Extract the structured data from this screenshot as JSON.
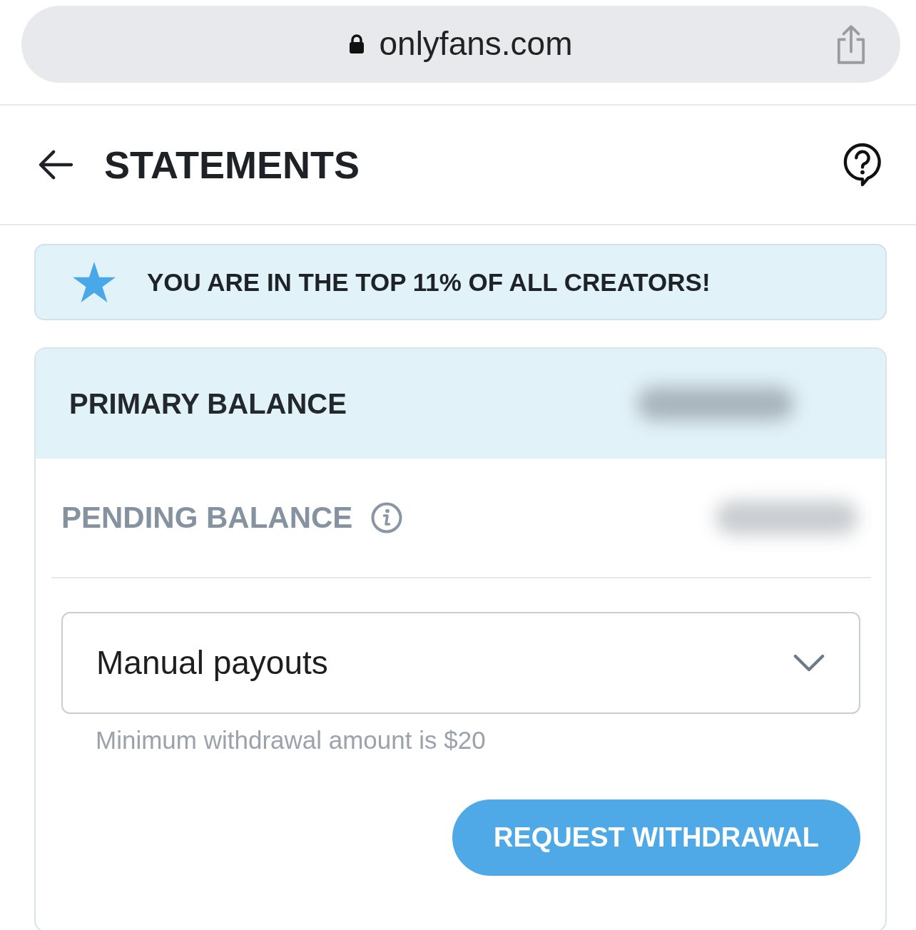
{
  "address_bar": {
    "url": "onlyfans.com"
  },
  "header": {
    "title": "STATEMENTS"
  },
  "banner": {
    "text": "YOU ARE IN THE TOP 11% OF ALL CREATORS!"
  },
  "balances": [
    {
      "kind": "primary",
      "label": "PRIMARY BALANCE",
      "value_blurred": true
    },
    {
      "kind": "pending",
      "label": "PENDING BALANCE",
      "value_blurred": true
    }
  ],
  "payout_select": {
    "value": "Manual payouts"
  },
  "hint": "Minimum withdrawal amount is $20",
  "buttons": [
    {
      "label": "REQUEST WITHDRAWAL"
    }
  ]
}
